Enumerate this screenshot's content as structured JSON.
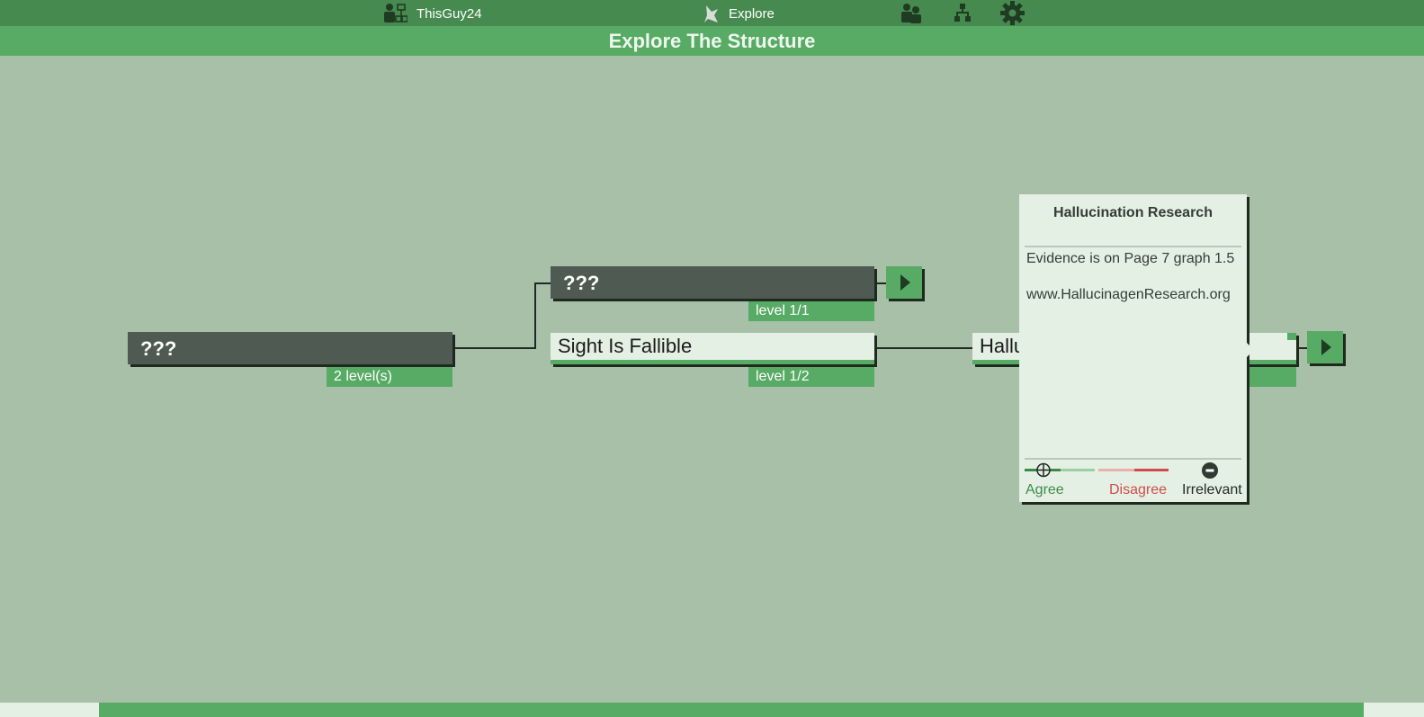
{
  "nav": {
    "user_name": "ThisGuy24",
    "explore_label": "Explore",
    "icons": [
      "user-tree-icon",
      "bird-icon",
      "people-icon",
      "hierarchy-icon",
      "gear-icon"
    ]
  },
  "page": {
    "title": "Explore The Structure"
  },
  "nodes": {
    "root": {
      "text": "???",
      "level": "2 level(s)"
    },
    "child1": {
      "text": "???",
      "level": "level 1/1"
    },
    "child2": {
      "text": "Sight Is Fallible",
      "level": "level 1/2"
    },
    "child3": {
      "text": "Hallucination Research"
    }
  },
  "popup": {
    "title": "Hallucination Research",
    "body_line1": "Evidence is on Page 7 graph 1.5",
    "body_line2": "www.HallucinagenResearch.org",
    "agree": "Agree",
    "disagree": "Disagree",
    "irrelevant": "Irrelevant"
  },
  "colors": {
    "background": "#a8bfa8",
    "header": "#468a50",
    "accent": "#58ab65",
    "node_dark": "#4f5a52",
    "node_light": "#e4f0e4",
    "disagree": "#d24b4b"
  }
}
